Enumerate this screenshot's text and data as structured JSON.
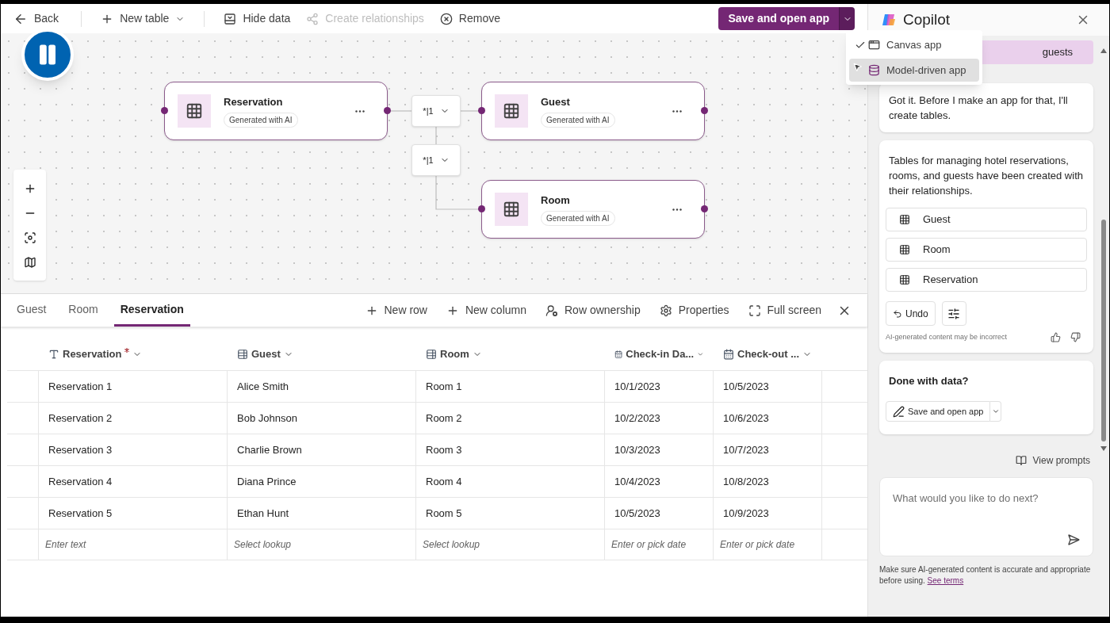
{
  "toolbar": {
    "back": "Back",
    "items": [
      {
        "label": "New table",
        "disabled": false,
        "caret": true
      },
      {
        "label": "Hide data",
        "disabled": false,
        "caret": false
      },
      {
        "label": "Create relationships",
        "disabled": true,
        "caret": false
      },
      {
        "label": "Remove",
        "disabled": false,
        "caret": false
      }
    ],
    "save_button": "Save and open app"
  },
  "save_menu": {
    "items": [
      {
        "label": "Canvas app",
        "checked": true,
        "selected": false
      },
      {
        "label": "Model-driven app",
        "checked": false,
        "selected": true
      }
    ]
  },
  "canvas": {
    "nodes": [
      {
        "name": "Reservation",
        "badge": "Generated with AI"
      },
      {
        "name": "Guest",
        "badge": "Generated with AI"
      },
      {
        "name": "Room",
        "badge": "Generated with AI"
      }
    ],
    "relationships": [
      {
        "label": "*|1"
      },
      {
        "label": "*|1"
      }
    ]
  },
  "data_panel": {
    "tabs": [
      {
        "label": "Guest",
        "selected": false
      },
      {
        "label": "Room",
        "selected": false
      },
      {
        "label": "Reservation",
        "selected": true
      }
    ],
    "actions": [
      {
        "label": "New row"
      },
      {
        "label": "New column"
      },
      {
        "label": "Row ownership"
      },
      {
        "label": "Properties"
      },
      {
        "label": "Full screen"
      }
    ],
    "columns": [
      {
        "label": "Reservation",
        "kind": "text",
        "required": true
      },
      {
        "label": "Guest",
        "kind": "lookup",
        "required": false
      },
      {
        "label": "Room",
        "kind": "lookup",
        "required": false
      },
      {
        "label": "Check-in Da...",
        "kind": "date",
        "required": false
      },
      {
        "label": "Check-out ...",
        "kind": "date",
        "required": false
      }
    ],
    "rows": [
      [
        "Reservation 1",
        "Alice Smith",
        "Room 1",
        "10/1/2023",
        "10/5/2023"
      ],
      [
        "Reservation 2",
        "Bob Johnson",
        "Room 2",
        "10/2/2023",
        "10/6/2023"
      ],
      [
        "Reservation 3",
        "Charlie Brown",
        "Room 3",
        "10/3/2023",
        "10/7/2023"
      ],
      [
        "Reservation 4",
        "Diana Prince",
        "Room 4",
        "10/4/2023",
        "10/8/2023"
      ],
      [
        "Reservation 5",
        "Ethan Hunt",
        "Room 5",
        "10/5/2023",
        "10/9/2023"
      ]
    ],
    "new_row": [
      "Enter text",
      "Select lookup",
      "Select lookup",
      "Enter or pick date",
      "Enter or pick date"
    ]
  },
  "copilot": {
    "title": "Copilot",
    "user_message": "guests",
    "reply": "Got it. Before I make an app for that, I'll create tables.",
    "summary": "Tables for managing hotel reservations, rooms, and guests have been created with their relationships.",
    "tables": [
      "Guest",
      "Room",
      "Reservation"
    ],
    "undo": "Undo",
    "disclaimer": "AI-generated content may be incorrect",
    "done_title": "Done with data?",
    "done_button": "Save and open app",
    "view_prompts": "View prompts",
    "input_placeholder": "What would you like to do next?",
    "footer": "Make sure AI-generated content is accurate and appropriate before using.",
    "footer_link": "See terms"
  }
}
